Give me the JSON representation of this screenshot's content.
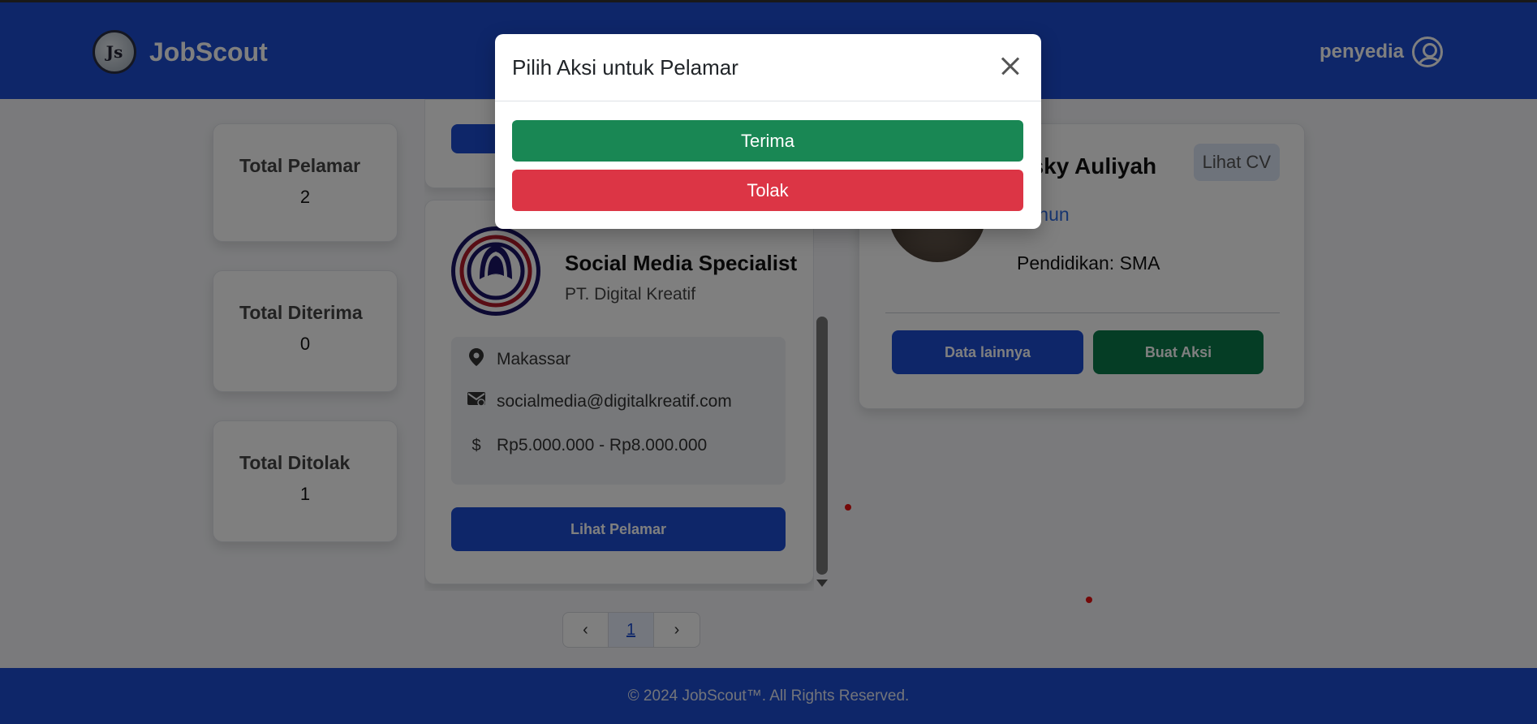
{
  "navbar": {
    "brand": "JobScout",
    "logo_text": "Js",
    "user_label": "penyedia"
  },
  "stats": [
    {
      "title": "Total Pelamar",
      "value": "2"
    },
    {
      "title": "Total Diterima",
      "value": "0"
    },
    {
      "title": "Total Ditolak",
      "value": "1"
    }
  ],
  "job": {
    "title": "Social Media Specialist",
    "company": "PT. Digital Kreatif",
    "location": "Makassar",
    "email": "socialmedia@digitalkreatif.com",
    "salary": "Rp5.000.000 - Rp8.000.000",
    "view_applicants_label": "Lihat Pelamar",
    "icons": {
      "location": "map-pin-icon",
      "email": "mail-icon",
      "salary": "dollar-icon"
    }
  },
  "pagination": {
    "prev": "‹",
    "current": "1",
    "next": "›"
  },
  "applicant": {
    "name_visible": "esky Auliyah",
    "age_visible": "Tahun",
    "education": "Pendidikan: SMA",
    "cv_label": "Lihat CV",
    "more_data_label": "Data lainnya",
    "action_label": "Buat Aksi"
  },
  "modal": {
    "title": "Pilih Aksi untuk Pelamar",
    "accept_label": "Terima",
    "reject_label": "Tolak"
  },
  "footer": {
    "text": "© 2024 JobScout™. All Rights Reserved."
  },
  "colors": {
    "primary": "#1d4cd2",
    "success": "#198754",
    "danger": "#dc3545",
    "action_dark_green": "#0b7a4b"
  }
}
